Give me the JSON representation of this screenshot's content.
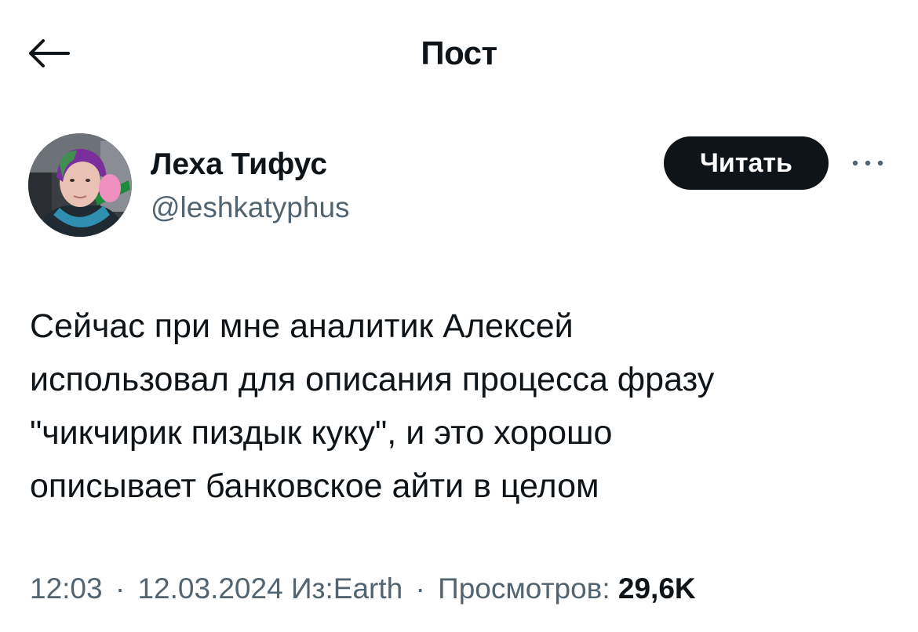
{
  "header": {
    "title": "Пост"
  },
  "author": {
    "display_name": "Леха Тифус",
    "handle": "@leshkatyphus",
    "follow_label": "Читать"
  },
  "tweet": {
    "lines": [
      "Сейчас при мне аналитик Алексей",
      "использовал для описания процесса фразу",
      "\"чикчирик пиздык куку\", и это хорошо",
      "описывает банковское айти в целом"
    ]
  },
  "meta": {
    "time": "12:03",
    "separator": "·",
    "date": "12.03.2024",
    "source": "Из:Earth",
    "views_label": "Просмотров:",
    "views_count": "29,6K"
  },
  "icons": {
    "back": "arrow-left-icon",
    "more": "more-horizontal-icon"
  },
  "colors": {
    "text_primary": "#0f1419",
    "text_secondary": "#536471",
    "button_bg": "#0f1419",
    "button_text": "#ffffff"
  }
}
